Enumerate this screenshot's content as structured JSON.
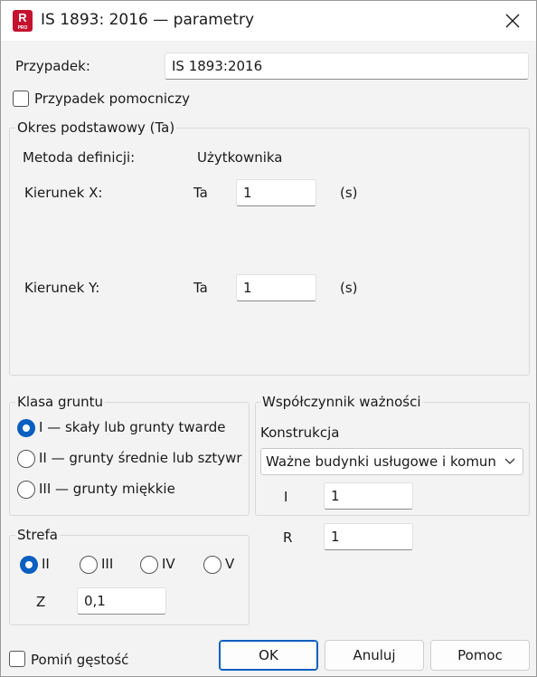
{
  "window": {
    "title": "IS 1893: 2016 — parametry",
    "app_icon_letter": "R",
    "app_icon_badge": "PRO",
    "accent_color": "#0a5fc0",
    "icons": [
      "app-icon",
      "close-icon",
      "chevron-down-icon"
    ]
  },
  "case": {
    "label": "Przypadek:",
    "value": "IS 1893:2016",
    "auxiliary_label": "Przypadek pomocniczy",
    "auxiliary_checked": false
  },
  "base_period": {
    "group_title": "Okres podstawowy (Ta)",
    "method_label": "Metoda definicji:",
    "method_value": "Użytkownika",
    "dir_x": {
      "label": "Kierunek X:",
      "symbol": "Ta",
      "value": "1",
      "unit": "(s)"
    },
    "dir_y": {
      "label": "Kierunek Y:",
      "symbol": "Ta",
      "value": "1",
      "unit": "(s)"
    }
  },
  "soil": {
    "group_title": "Klasa gruntu",
    "selected": 0,
    "options": [
      "I — skały lub grunty twarde",
      "II — grunty średnie lub sztywr",
      "III — grunty miękkie"
    ]
  },
  "zone": {
    "group_title": "Strefa",
    "selected": 0,
    "options": [
      "II",
      "III",
      "IV",
      "V"
    ],
    "z_label": "Z",
    "z_value": "0,1"
  },
  "importance": {
    "group_title": "Współczynnik ważności",
    "construction_label": "Konstrukcja",
    "construction_value": "Ważne budynki usługowe i komunalne",
    "i_label": "I",
    "i_value": "1",
    "r_label": "R",
    "r_value": "1"
  },
  "footer": {
    "skip_density_label": "Pomiń gęstość",
    "skip_density_checked": false,
    "ok": "OK",
    "cancel": "Anuluj",
    "help": "Pomoc"
  }
}
